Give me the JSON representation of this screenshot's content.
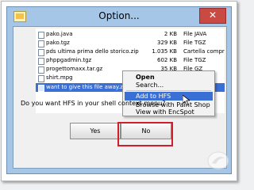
{
  "window": {
    "title": "Option...",
    "close_label": "✕"
  },
  "files": [
    {
      "name": "pako.java",
      "size": "2 KB",
      "type": "File JAVA",
      "selected": false
    },
    {
      "name": "pako.tgz",
      "size": "329 KB",
      "type": "File TGZ",
      "selected": false
    },
    {
      "name": "pds ultima prima dello storico.zip",
      "size": "1.035 KB",
      "type": "Cartella compr",
      "selected": false
    },
    {
      "name": "phppgadmin.tgz",
      "size": "602 KB",
      "type": "File TGZ",
      "selected": false
    },
    {
      "name": "progettomaxx.tar.gz",
      "size": "35 KB",
      "type": "File GZ",
      "selected": false
    },
    {
      "name": "shirt.mpg",
      "size": "",
      "type": "",
      "selected": false
    },
    {
      "name": "want to give this file away.zip",
      "size": "",
      "type": "",
      "selected": true
    }
  ],
  "context_menu": {
    "items": [
      {
        "label": "Open",
        "bold": true,
        "highlighted": false
      },
      {
        "label": "Search...",
        "bold": false,
        "highlighted": false
      },
      {
        "label": "Add to HFS",
        "bold": false,
        "highlighted": true
      },
      {
        "label": "Browse with Paint Shop Pro 9",
        "bold": false,
        "highlighted": false
      },
      {
        "label": "View with EncSpot",
        "bold": false,
        "highlighted": false
      }
    ]
  },
  "prompt": {
    "question": "Do you want HFS in your shell context menu?"
  },
  "buttons": {
    "yes_label": "Yes",
    "no_label": "No"
  },
  "colors": {
    "highlight_border": "#d01f2a",
    "selection": "#3a6fd6",
    "title_bar": "#a5c6e6",
    "close_button": "#c94a42"
  }
}
